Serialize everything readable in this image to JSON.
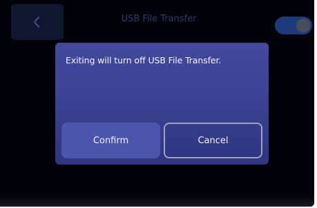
{
  "header": {
    "title": "USB File Transfer",
    "back_icon": "chevron-left-icon",
    "toggle_state": "on"
  },
  "dialog": {
    "message": "Exiting will turn off USB File Transfer.",
    "confirm_label": "Confirm",
    "cancel_label": "Cancel"
  },
  "colors": {
    "dialog_bg": "#3b4293",
    "confirm_bg": "#4c55ac",
    "screen_bg": "#02030a"
  }
}
